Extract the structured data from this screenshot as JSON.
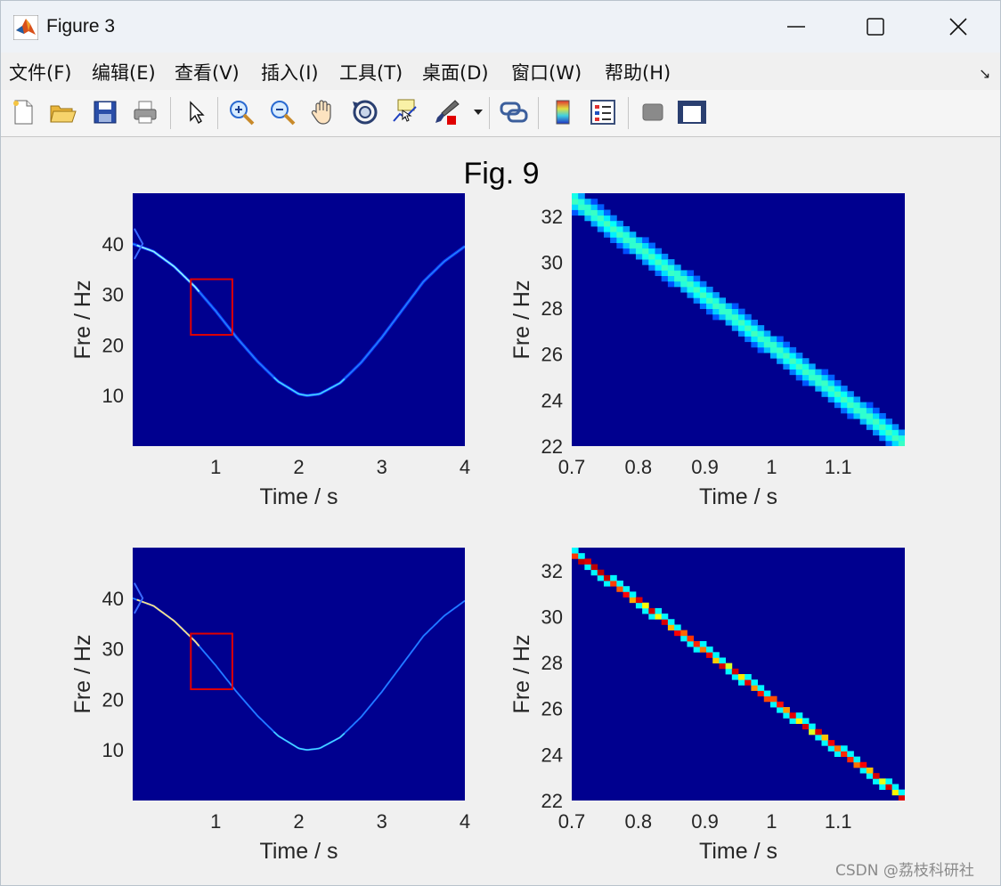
{
  "window": {
    "title": "Figure 3",
    "controls": [
      "minimize",
      "maximize",
      "close"
    ]
  },
  "menubar": {
    "items": [
      {
        "label": "文件(F)"
      },
      {
        "label": "编辑(E)"
      },
      {
        "label": "查看(V)"
      },
      {
        "label": "插入(I)"
      },
      {
        "label": "工具(T)"
      },
      {
        "label": "桌面(D)"
      },
      {
        "label": "窗口(W)"
      },
      {
        "label": "帮助(H)"
      }
    ],
    "dock_icon": "↘"
  },
  "toolbar": {
    "buttons": [
      "new-figure-icon",
      "open-file-icon",
      "save-icon",
      "print-icon",
      "select-arrow-icon",
      "zoom-in-icon",
      "zoom-out-icon",
      "pan-hand-icon",
      "rotate-3d-icon",
      "data-cursor-icon",
      "brush-icon",
      "link-plot-icon",
      "colorbar-icon",
      "legend-icon",
      "hide-plot-tools-icon",
      "show-plot-tools-icon"
    ]
  },
  "figure": {
    "title": "Fig. 9",
    "watermark": "CSDN @荔枝科研社"
  },
  "colors": {
    "background_dark_blue": "#00008f",
    "curve_blue": "#1040ff",
    "zoom_box_red": "#e00000",
    "figure_bg": "#f0f0f0"
  },
  "chart_data": [
    {
      "type": "heatmap",
      "position": "top-left",
      "xlabel": "Time / s",
      "ylabel": "Fre / Hz",
      "xlim": [
        0,
        4
      ],
      "ylim": [
        0,
        50
      ],
      "xticks": [
        "1",
        "2",
        "3",
        "4"
      ],
      "yticks": [
        "10",
        "20",
        "30",
        "40"
      ],
      "ridge": {
        "x": [
          0.0,
          0.25,
          0.5,
          0.75,
          1.0,
          1.25,
          1.5,
          1.75,
          2.0,
          2.1,
          2.25,
          2.5,
          2.75,
          3.0,
          3.25,
          3.5,
          3.75,
          4.0
        ],
        "y": [
          40,
          38.5,
          35.5,
          31.5,
          26.7,
          21.5,
          16.8,
          12.8,
          10.3,
          10,
          10.3,
          12.5,
          16.5,
          21.5,
          27,
          32.5,
          36.5,
          39.5
        ]
      },
      "zoom_box": {
        "x": [
          0.7,
          1.2
        ],
        "y": [
          22,
          33
        ]
      }
    },
    {
      "type": "heatmap",
      "position": "top-right",
      "xlabel": "Time / s",
      "ylabel": "Fre / Hz",
      "xlim": [
        0.7,
        1.2
      ],
      "ylim": [
        22,
        33
      ],
      "xticks": [
        "0.7",
        "0.8",
        "0.9",
        "1",
        "1.1"
      ],
      "yticks": [
        "22",
        "24",
        "26",
        "28",
        "30",
        "32"
      ],
      "ridge": {
        "x": [
          0.7,
          1.2
        ],
        "y": [
          32.8,
          22.1
        ]
      },
      "ridge_style": "wide, blurred"
    },
    {
      "type": "heatmap",
      "position": "bottom-left",
      "xlabel": "Time / s",
      "ylabel": "Fre / Hz",
      "xlim": [
        0,
        4
      ],
      "ylim": [
        0,
        50
      ],
      "xticks": [
        "1",
        "2",
        "3",
        "4"
      ],
      "yticks": [
        "10",
        "20",
        "30",
        "40"
      ],
      "ridge": {
        "x": [
          0.0,
          0.25,
          0.5,
          0.75,
          1.0,
          1.25,
          1.5,
          1.75,
          2.0,
          2.1,
          2.25,
          2.5,
          2.75,
          3.0,
          3.25,
          3.5,
          3.75,
          4.0
        ],
        "y": [
          40,
          38.5,
          35.5,
          31.5,
          26.7,
          21.5,
          16.8,
          12.8,
          10.3,
          10,
          10.3,
          12.5,
          16.5,
          21.5,
          27,
          32.5,
          36.5,
          39.5
        ]
      },
      "zoom_box": {
        "x": [
          0.7,
          1.2
        ],
        "y": [
          22,
          33
        ]
      }
    },
    {
      "type": "heatmap",
      "position": "bottom-right",
      "xlabel": "Time / s",
      "ylabel": "Fre / Hz",
      "xlim": [
        0.7,
        1.2
      ],
      "ylim": [
        22,
        33
      ],
      "xticks": [
        "0.7",
        "0.8",
        "0.9",
        "1",
        "1.1"
      ],
      "yticks": [
        "22",
        "24",
        "26",
        "28",
        "30",
        "32"
      ],
      "ridge": {
        "x": [
          0.7,
          1.2
        ],
        "y": [
          32.8,
          22.1
        ]
      },
      "ridge_style": "thin, pixelated, high energy"
    }
  ]
}
